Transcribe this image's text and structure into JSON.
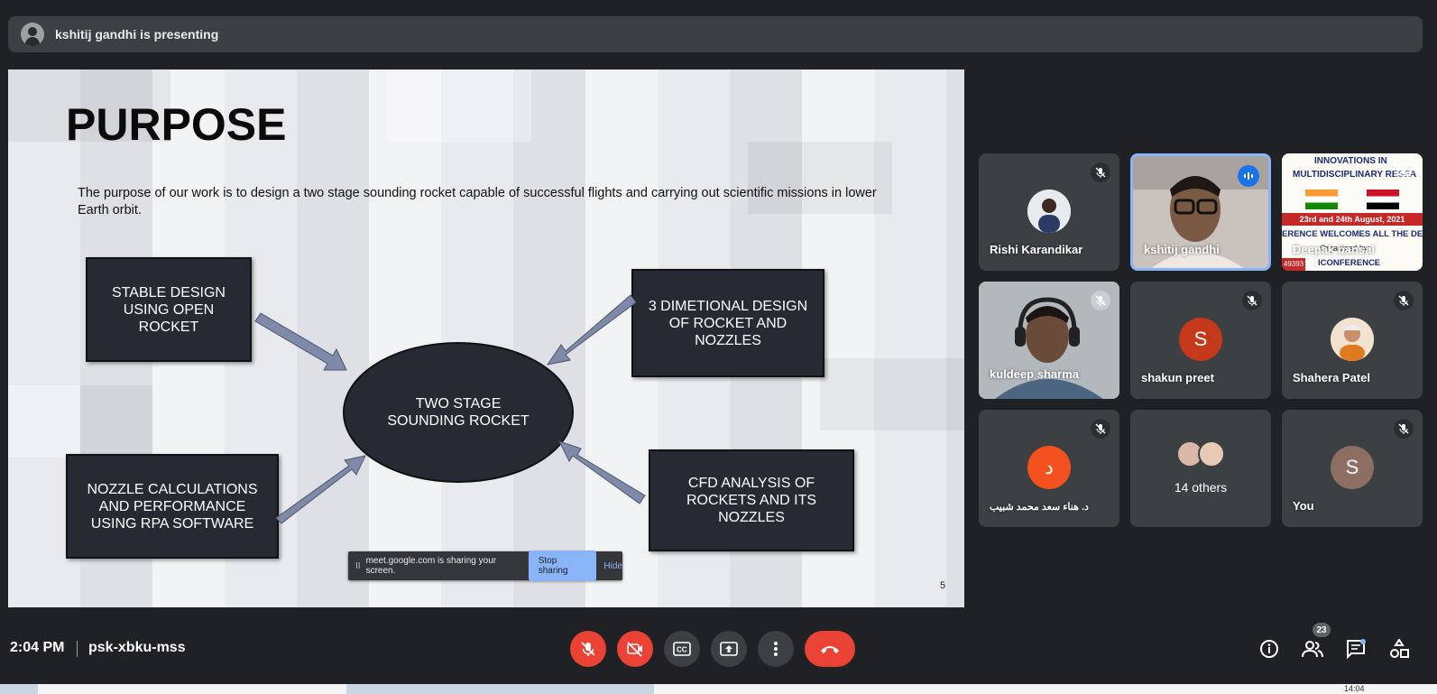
{
  "presenter_banner": {
    "text": "kshitij gandhi is presenting"
  },
  "slide": {
    "title": "PURPOSE",
    "paragraph": "The purpose of our work is to design a two stage sounding rocket capable of successful flights and carrying out scientific missions in lower Earth orbit.",
    "center": "TWO STAGE SOUNDING ROCKET",
    "box_top_left": "STABLE DESIGN USING OPEN ROCKET",
    "box_top_right": "3 DIMETIONAL DESIGN OF ROCKET AND NOZZLES",
    "box_bottom_left": "NOZZLE CALCULATIONS AND PERFORMANCE USING RPA SOFTWARE",
    "box_bottom_right": "CFD ANALYSIS OF ROCKETS AND ITS NOZZLES",
    "page_number": "5"
  },
  "share_bar": {
    "pause_icon": "II",
    "message": "meet.google.com is sharing your screen.",
    "stop_label": "Stop sharing",
    "hide_label": "Hide"
  },
  "participants": [
    {
      "name": "Rishi Karandikar",
      "muted": true
    },
    {
      "name": "kshitij gandhi",
      "speaking": true
    },
    {
      "name": "Deepak bansal",
      "muted": true
    },
    {
      "name": "kuldeep sharma",
      "muted": true
    },
    {
      "name": "shakun preet",
      "initial": "S",
      "color": "#c5391a",
      "muted": true
    },
    {
      "name": "Shahera Patel",
      "muted": true
    },
    {
      "name": "د. هناء سعد محمد شبيب",
      "initial": "د",
      "color": "#f4511e",
      "muted": true
    },
    {
      "name": "14 others"
    },
    {
      "name": "You",
      "initial": "S",
      "color": "#8d6e63",
      "muted": true
    }
  ],
  "poster": {
    "line1": "INNOVATIONS IN",
    "line2": "MULTIDISCIPLINARY RESEA",
    "line3": "23rd and 24th August, 2021",
    "line4": "ERENCE WELCOMES ALL THE DEL",
    "line5": "Organized by:",
    "line6": "ICONFERENCE",
    "line7": "49393"
  },
  "bottom_bar": {
    "time": "2:04 PM",
    "meeting_code": "psk-xbku-mss",
    "participant_count": "23"
  },
  "taskbar": {
    "clock": "14:04"
  },
  "colors": {
    "red": "#ea4335",
    "blue": "#1a73e8",
    "bg": "#202124",
    "tile": "#3c4043"
  },
  "icons": [
    "mic-off-icon",
    "camera-off-icon",
    "captions-icon",
    "present-icon",
    "more-icon",
    "end-call-icon",
    "info-icon",
    "people-icon",
    "chat-icon",
    "activities-icon"
  ]
}
